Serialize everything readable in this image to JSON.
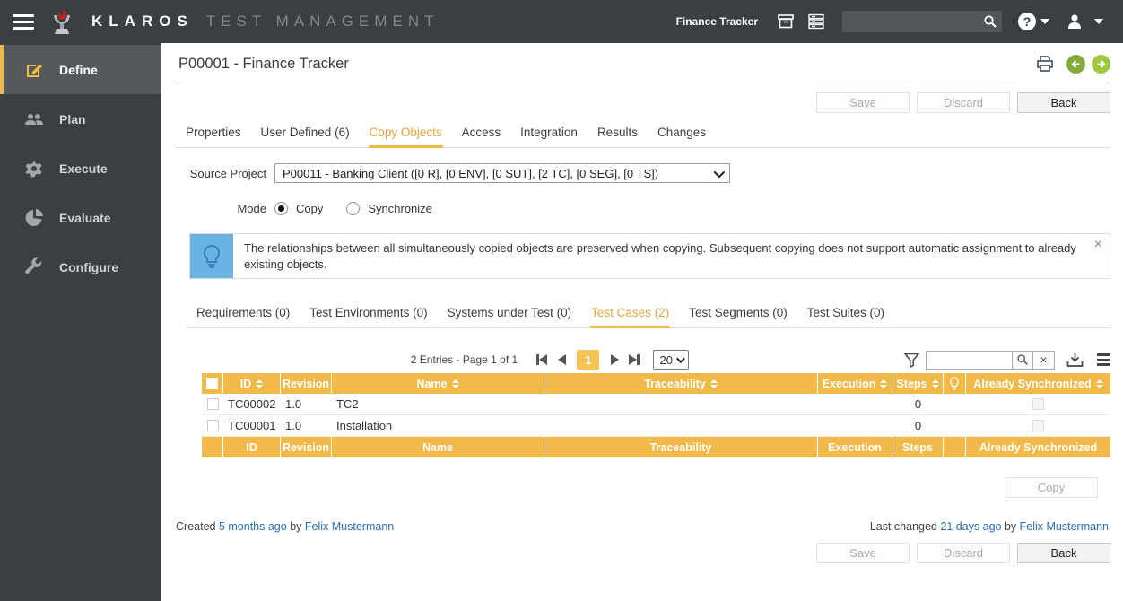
{
  "header": {
    "brand_primary": "KLAROS",
    "brand_secondary": "TEST MANAGEMENT",
    "project_name": "Finance Tracker",
    "help_glyph": "?"
  },
  "sidebar": {
    "items": [
      {
        "label": "Define"
      },
      {
        "label": "Plan"
      },
      {
        "label": "Execute"
      },
      {
        "label": "Evaluate"
      },
      {
        "label": "Configure"
      }
    ]
  },
  "page": {
    "title": "P00001 - Finance Tracker"
  },
  "buttons": {
    "save": "Save",
    "discard": "Discard",
    "back": "Back",
    "copy": "Copy"
  },
  "tabs": [
    {
      "label": "Properties"
    },
    {
      "label": "User Defined (6)"
    },
    {
      "label": "Copy Objects"
    },
    {
      "label": "Access"
    },
    {
      "label": "Integration"
    },
    {
      "label": "Results"
    },
    {
      "label": "Changes"
    }
  ],
  "form": {
    "source_project_label": "Source Project",
    "source_project_value": "P00011 - Banking Client ([0 R], [0 ENV], [0 SUT], [2 TC], [0 SEG], [0 TS])",
    "mode_label": "Mode",
    "mode_copy": "Copy",
    "mode_synchronize": "Synchronize"
  },
  "info_box": {
    "message": "The relationships between all simultaneously copied objects are preserved when copying. Subsequent copying does not support automatic assignment to already existing objects.",
    "close_glyph": "×"
  },
  "subtabs": [
    {
      "label": "Requirements (0)"
    },
    {
      "label": "Test Environments (0)"
    },
    {
      "label": "Systems under Test (0)"
    },
    {
      "label": "Test Cases (2)"
    },
    {
      "label": "Test Segments (0)"
    },
    {
      "label": "Test Suites (0)"
    }
  ],
  "table": {
    "summary": "2 Entries - Page 1 of 1",
    "current_page": "1",
    "page_size": "20",
    "columns": {
      "id": "ID",
      "revision": "Revision",
      "name": "Name",
      "traceability": "Traceability",
      "execution": "Execution",
      "steps": "Steps",
      "already_synchronized": "Already Synchronized"
    },
    "rows": [
      {
        "id": "TC00002",
        "revision": "1.0",
        "name": "TC2",
        "traceability": "",
        "execution": "",
        "steps": "0"
      },
      {
        "id": "TC00001",
        "revision": "1.0",
        "name": "Installation",
        "traceability": "",
        "execution": "",
        "steps": "0"
      }
    ]
  },
  "meta": {
    "created_prefix": "Created",
    "created_time": "5 months ago",
    "created_by": "by",
    "created_user": "Felix Mustermann",
    "changed_prefix": "Last changed",
    "changed_time": "21 days ago",
    "changed_by": "by",
    "changed_user": "Felix Mustermann"
  },
  "colors": {
    "accent_yellow": "#f0b94a",
    "active_tab_orange": "#e8a43c",
    "link_blue": "#2a6db5",
    "info_blue": "#68b3e2",
    "nav_back_green": "#84aa3c",
    "nav_forward_green": "#a0c83e",
    "topbar_dark": "#3a3f42"
  }
}
